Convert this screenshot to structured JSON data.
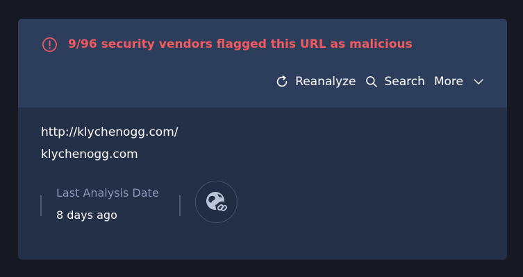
{
  "alert": {
    "message": "9/96 security vendors flagged this URL as malicious",
    "icon": "alert-circle-icon",
    "color": "#f15a5f"
  },
  "actions": {
    "reanalyze_label": "Reanalyze",
    "search_label": "Search",
    "more_label": "More"
  },
  "target": {
    "url": "http://klychenogg.com/",
    "domain": "klychenogg.com"
  },
  "analysis": {
    "label": "Last Analysis Date",
    "value": "8 days ago"
  },
  "colors": {
    "page_background": "#161824",
    "header_background": "#2d3e5d",
    "body_background": "#242f48",
    "muted_text": "#8c98b6"
  }
}
